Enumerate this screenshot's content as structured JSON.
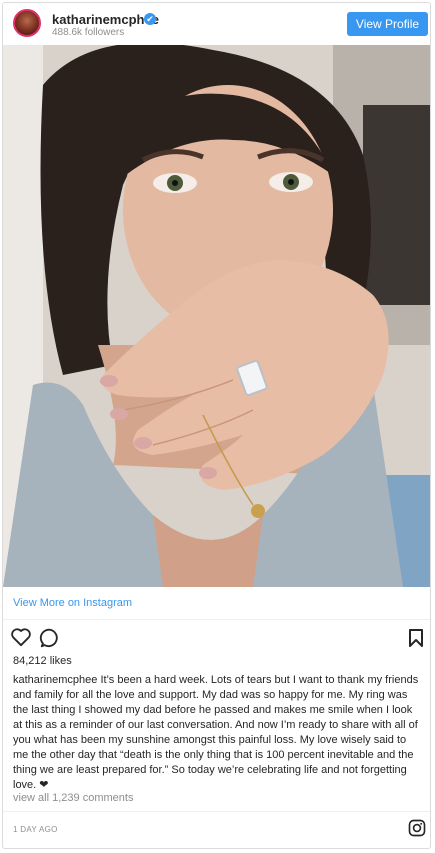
{
  "header": {
    "username": "katharinemcphee",
    "verified_mark": "✔",
    "followers": "488.6k followers",
    "view_profile_label": "View Profile"
  },
  "post": {
    "view_more_label": "View More on Instagram",
    "likes": "84,212 likes",
    "caption_user": "katharinemcphee",
    "caption_text": " It’s been a hard week. Lots of tears but I want to thank my friends and family for all the love and support. My dad was so happy for me. My ring was the last thing I showed my dad before he passed and makes me smile when I look at this as a reminder of our last conversation. And now I’m ready to share with all of you what has been my sunshine amongst this painful loss. My love wisely said to me the other day that “death is the only thing that is 100 percent inevitable and the thing we are least prepared for.” So today we’re celebrating life and not forgetting love. ❤",
    "comments_label": "view all 1,239 comments",
    "timestamp": "1 DAY AGO"
  },
  "icons": {
    "like": "heart-icon",
    "comment": "comment-icon",
    "save": "bookmark-icon",
    "instagram": "instagram-icon"
  },
  "colors": {
    "accent": "#3897f0",
    "text": "#262626",
    "muted": "#8e8e8e"
  }
}
